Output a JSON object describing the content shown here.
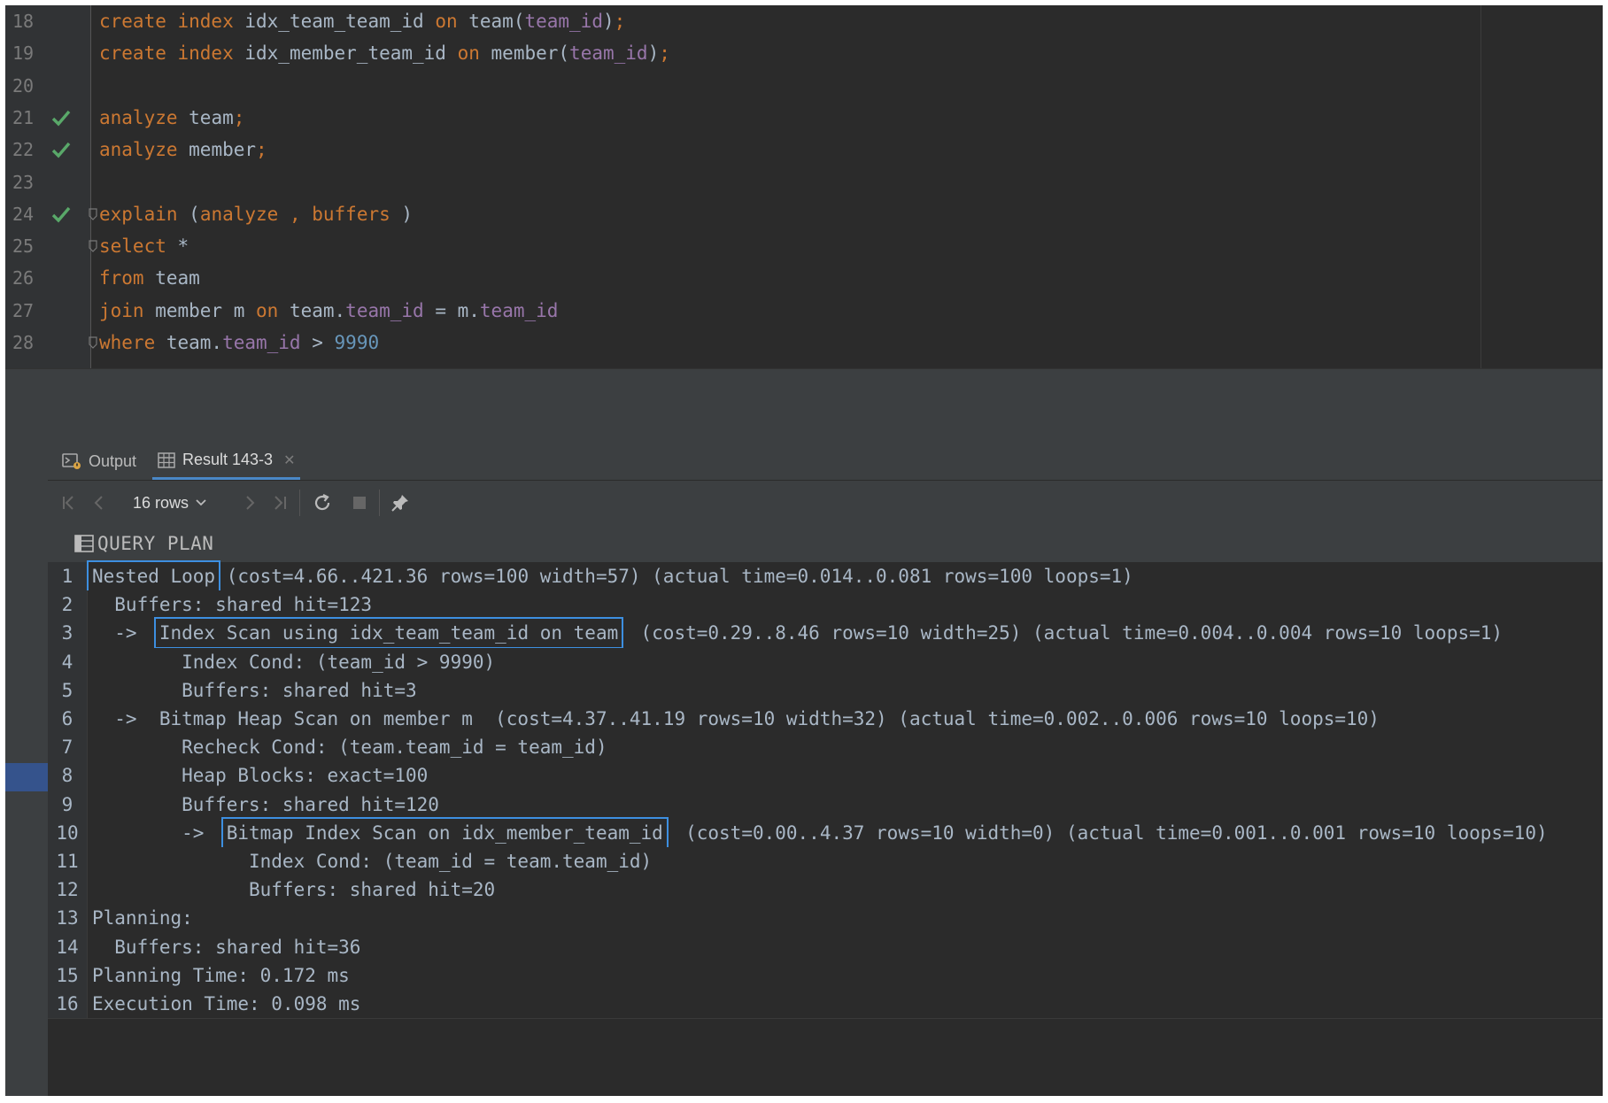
{
  "editor": {
    "lines": [
      {
        "num": "18",
        "check": false,
        "fold": false,
        "tokens": [
          [
            "kw",
            "create index "
          ],
          [
            "pl",
            "idx_team_team_id "
          ],
          [
            "kw",
            "on "
          ],
          [
            "pl",
            "team("
          ],
          [
            "fld",
            "team_id"
          ],
          [
            "pl",
            ")"
          ],
          [
            "kw",
            ";"
          ]
        ]
      },
      {
        "num": "19",
        "check": false,
        "fold": false,
        "tokens": [
          [
            "kw",
            "create index "
          ],
          [
            "pl",
            "idx_member_team_id "
          ],
          [
            "kw",
            "on "
          ],
          [
            "pl",
            "member("
          ],
          [
            "fld",
            "team_id"
          ],
          [
            "pl",
            ")"
          ],
          [
            "kw",
            ";"
          ]
        ]
      },
      {
        "num": "20",
        "check": false,
        "fold": false,
        "tokens": []
      },
      {
        "num": "21",
        "check": true,
        "fold": false,
        "tokens": [
          [
            "kw",
            "analyze "
          ],
          [
            "pl",
            "team"
          ],
          [
            "kw",
            ";"
          ]
        ]
      },
      {
        "num": "22",
        "check": true,
        "fold": false,
        "tokens": [
          [
            "kw",
            "analyze "
          ],
          [
            "pl",
            "member"
          ],
          [
            "kw",
            ";"
          ]
        ]
      },
      {
        "num": "23",
        "check": false,
        "fold": false,
        "tokens": []
      },
      {
        "num": "24",
        "check": true,
        "fold": true,
        "tokens": [
          [
            "kw",
            "explain "
          ],
          [
            "pl",
            "("
          ],
          [
            "kw",
            "analyze , buffers "
          ],
          [
            "pl",
            ")"
          ]
        ]
      },
      {
        "num": "25",
        "check": false,
        "fold": true,
        "tokens": [
          [
            "kw",
            "select "
          ],
          [
            "pl",
            "*"
          ]
        ]
      },
      {
        "num": "26",
        "check": false,
        "fold": false,
        "tokens": [
          [
            "kw",
            "from "
          ],
          [
            "pl",
            "team"
          ]
        ]
      },
      {
        "num": "27",
        "check": false,
        "fold": false,
        "tokens": [
          [
            "kw",
            "join "
          ],
          [
            "pl",
            "member m "
          ],
          [
            "kw",
            "on "
          ],
          [
            "pl",
            "team."
          ],
          [
            "fld",
            "team_id"
          ],
          [
            "pl",
            " = m."
          ],
          [
            "fld",
            "team_id"
          ]
        ]
      },
      {
        "num": "28",
        "check": false,
        "fold": true,
        "tokens": [
          [
            "kw",
            "where "
          ],
          [
            "pl",
            "team."
          ],
          [
            "fld",
            "team_id"
          ],
          [
            "pl",
            " > "
          ],
          [
            "num",
            "9990"
          ]
        ]
      }
    ]
  },
  "tabs": {
    "output_label": "Output",
    "result_label": "Result 143-3"
  },
  "toolbar": {
    "rows_label": "16 rows"
  },
  "grid": {
    "column_header": "QUERY PLAN",
    "rows": [
      {
        "n": "1",
        "pre": "",
        "hl": "Nested Loop",
        "post": " (cost=4.66..421.36 rows=100 width=57) (actual time=0.014..0.081 rows=100 loops=1)"
      },
      {
        "n": "2",
        "pre": "  Buffers: shared hit=123",
        "hl": "",
        "post": ""
      },
      {
        "n": "3",
        "pre": "  ->  ",
        "hl": "Index Scan using idx_team_team_id on team",
        "post": "  (cost=0.29..8.46 rows=10 width=25) (actual time=0.004..0.004 rows=10 loops=1)"
      },
      {
        "n": "4",
        "pre": "        Index Cond: (team_id > 9990)",
        "hl": "",
        "post": ""
      },
      {
        "n": "5",
        "pre": "        Buffers: shared hit=3",
        "hl": "",
        "post": ""
      },
      {
        "n": "6",
        "pre": "  ->  Bitmap Heap Scan on member m  (cost=4.37..41.19 rows=10 width=32) (actual time=0.002..0.006 rows=10 loops=10)",
        "hl": "",
        "post": ""
      },
      {
        "n": "7",
        "pre": "        Recheck Cond: (team.team_id = team_id)",
        "hl": "",
        "post": ""
      },
      {
        "n": "8",
        "pre": "        Heap Blocks: exact=100",
        "hl": "",
        "post": ""
      },
      {
        "n": "9",
        "pre": "        Buffers: shared hit=120",
        "hl": "",
        "post": ""
      },
      {
        "n": "10",
        "pre": "        ->  ",
        "hl": "Bitmap Index Scan on idx_member_team_id",
        "post": "  (cost=0.00..4.37 rows=10 width=0) (actual time=0.001..0.001 rows=10 loops=10)"
      },
      {
        "n": "11",
        "pre": "              Index Cond: (team_id = team.team_id)",
        "hl": "",
        "post": ""
      },
      {
        "n": "12",
        "pre": "              Buffers: shared hit=20",
        "hl": "",
        "post": ""
      },
      {
        "n": "13",
        "pre": "Planning:",
        "hl": "",
        "post": ""
      },
      {
        "n": "14",
        "pre": "  Buffers: shared hit=36",
        "hl": "",
        "post": ""
      },
      {
        "n": "15",
        "pre": "Planning Time: 0.172 ms",
        "hl": "",
        "post": ""
      },
      {
        "n": "16",
        "pre": "Execution Time: 0.098 ms",
        "hl": "",
        "post": ""
      }
    ]
  },
  "icons": {
    "check": "checkmark-icon",
    "output": "console-output-icon",
    "result": "table-grid-icon",
    "first": "first-page-icon",
    "prev": "previous-page-icon",
    "next": "next-page-icon",
    "last": "last-page-icon",
    "reload": "reload-icon",
    "stop": "stop-icon",
    "pin": "pin-icon",
    "column": "table-column-icon"
  },
  "colors": {
    "keyword": "#cc7832",
    "field": "#9876aa",
    "number": "#6897bb",
    "text": "#a9b7c6",
    "highlight_box": "#3d8fe0",
    "check": "#59a869"
  }
}
